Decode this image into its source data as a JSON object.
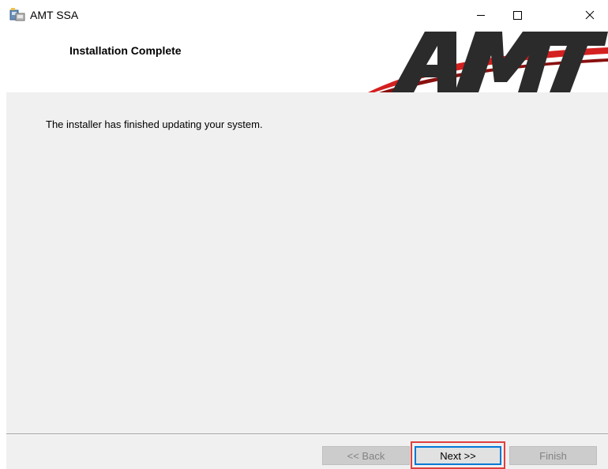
{
  "window": {
    "title": "AMT SSA",
    "icon": "installer-icon",
    "controls": {
      "minimize_icon": "minimize-icon",
      "maximize_icon": "maximize-icon",
      "close_icon": "close-icon"
    }
  },
  "header": {
    "title": "Installation Complete",
    "logo_text": "AMT",
    "logo_colors": {
      "dark": "#2b2b2b",
      "accent": "#d42020"
    }
  },
  "body": {
    "message": "The installer has finished updating your system."
  },
  "footer": {
    "back_label": "<< Back",
    "next_label": "Next >>",
    "finish_label": "Finish",
    "back_enabled": false,
    "next_enabled": true,
    "finish_enabled": false,
    "highlight_color": "#e04040"
  }
}
